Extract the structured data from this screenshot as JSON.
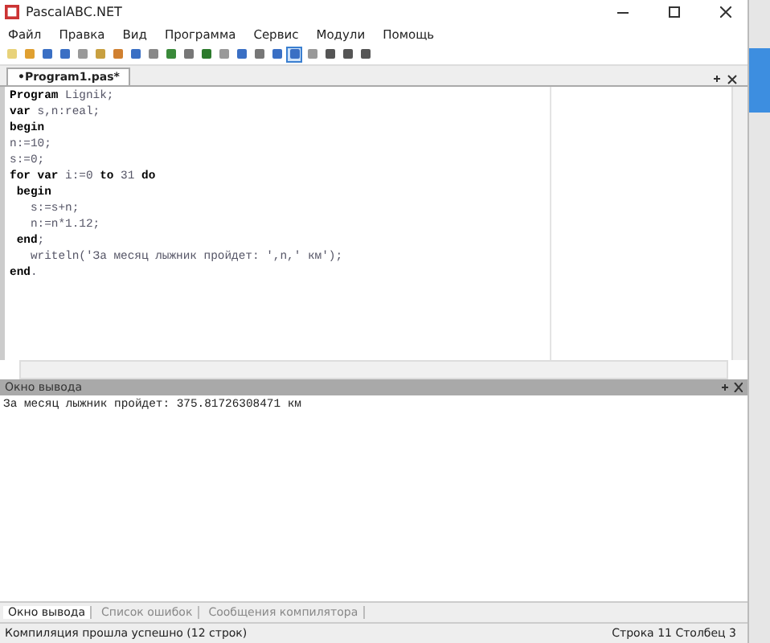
{
  "window": {
    "title": "PascalABC.NET"
  },
  "menu": [
    "Файл",
    "Правка",
    "Вид",
    "Программа",
    "Сервис",
    "Модули",
    "Помощь"
  ],
  "toolbar": [
    {
      "selected": false
    },
    {
      "selected": false
    },
    {
      "selected": false
    },
    {
      "selected": false
    },
    {
      "selected": false
    },
    {
      "selected": false
    },
    {
      "selected": false
    },
    {
      "selected": false
    },
    {
      "selected": false
    },
    {
      "selected": false
    },
    {
      "selected": false
    },
    {
      "selected": false
    },
    {
      "selected": false
    },
    {
      "selected": false
    },
    {
      "selected": false
    },
    {
      "selected": false
    },
    {
      "selected": true
    },
    {
      "selected": false
    },
    {
      "selected": false
    },
    {
      "selected": false
    },
    {
      "selected": false
    }
  ],
  "editor": {
    "tab": {
      "label": "•Program1.pas*",
      "selected": true
    },
    "lines": [
      "**Program** Lignik;",
      "**var** s,n:real;",
      "**begin**",
      "n:=10;",
      "s:=0;",
      "**for var** i:=0 **to** 31 **do**",
      " **begin**",
      "   s:=s+n;",
      "   n:=n*1.12;",
      " **end**;",
      "   writeln('За месяц лыжник пройдет: ',n,' км');",
      "**end**."
    ]
  },
  "output": {
    "title": "Окно вывода",
    "text": "За месяц лыжник пройдет: 375.81726308471 км"
  },
  "bottom_tabs": [
    {
      "label": "Окно вывода",
      "selected": true
    },
    {
      "label": "Список ошибок",
      "selected": false
    },
    {
      "label": "Сообщения компилятора",
      "selected": false
    }
  ],
  "status_bar": {
    "message": "Компиляция прошла успешно (12 строк)",
    "position": "Строка 11 Столбец 3"
  }
}
